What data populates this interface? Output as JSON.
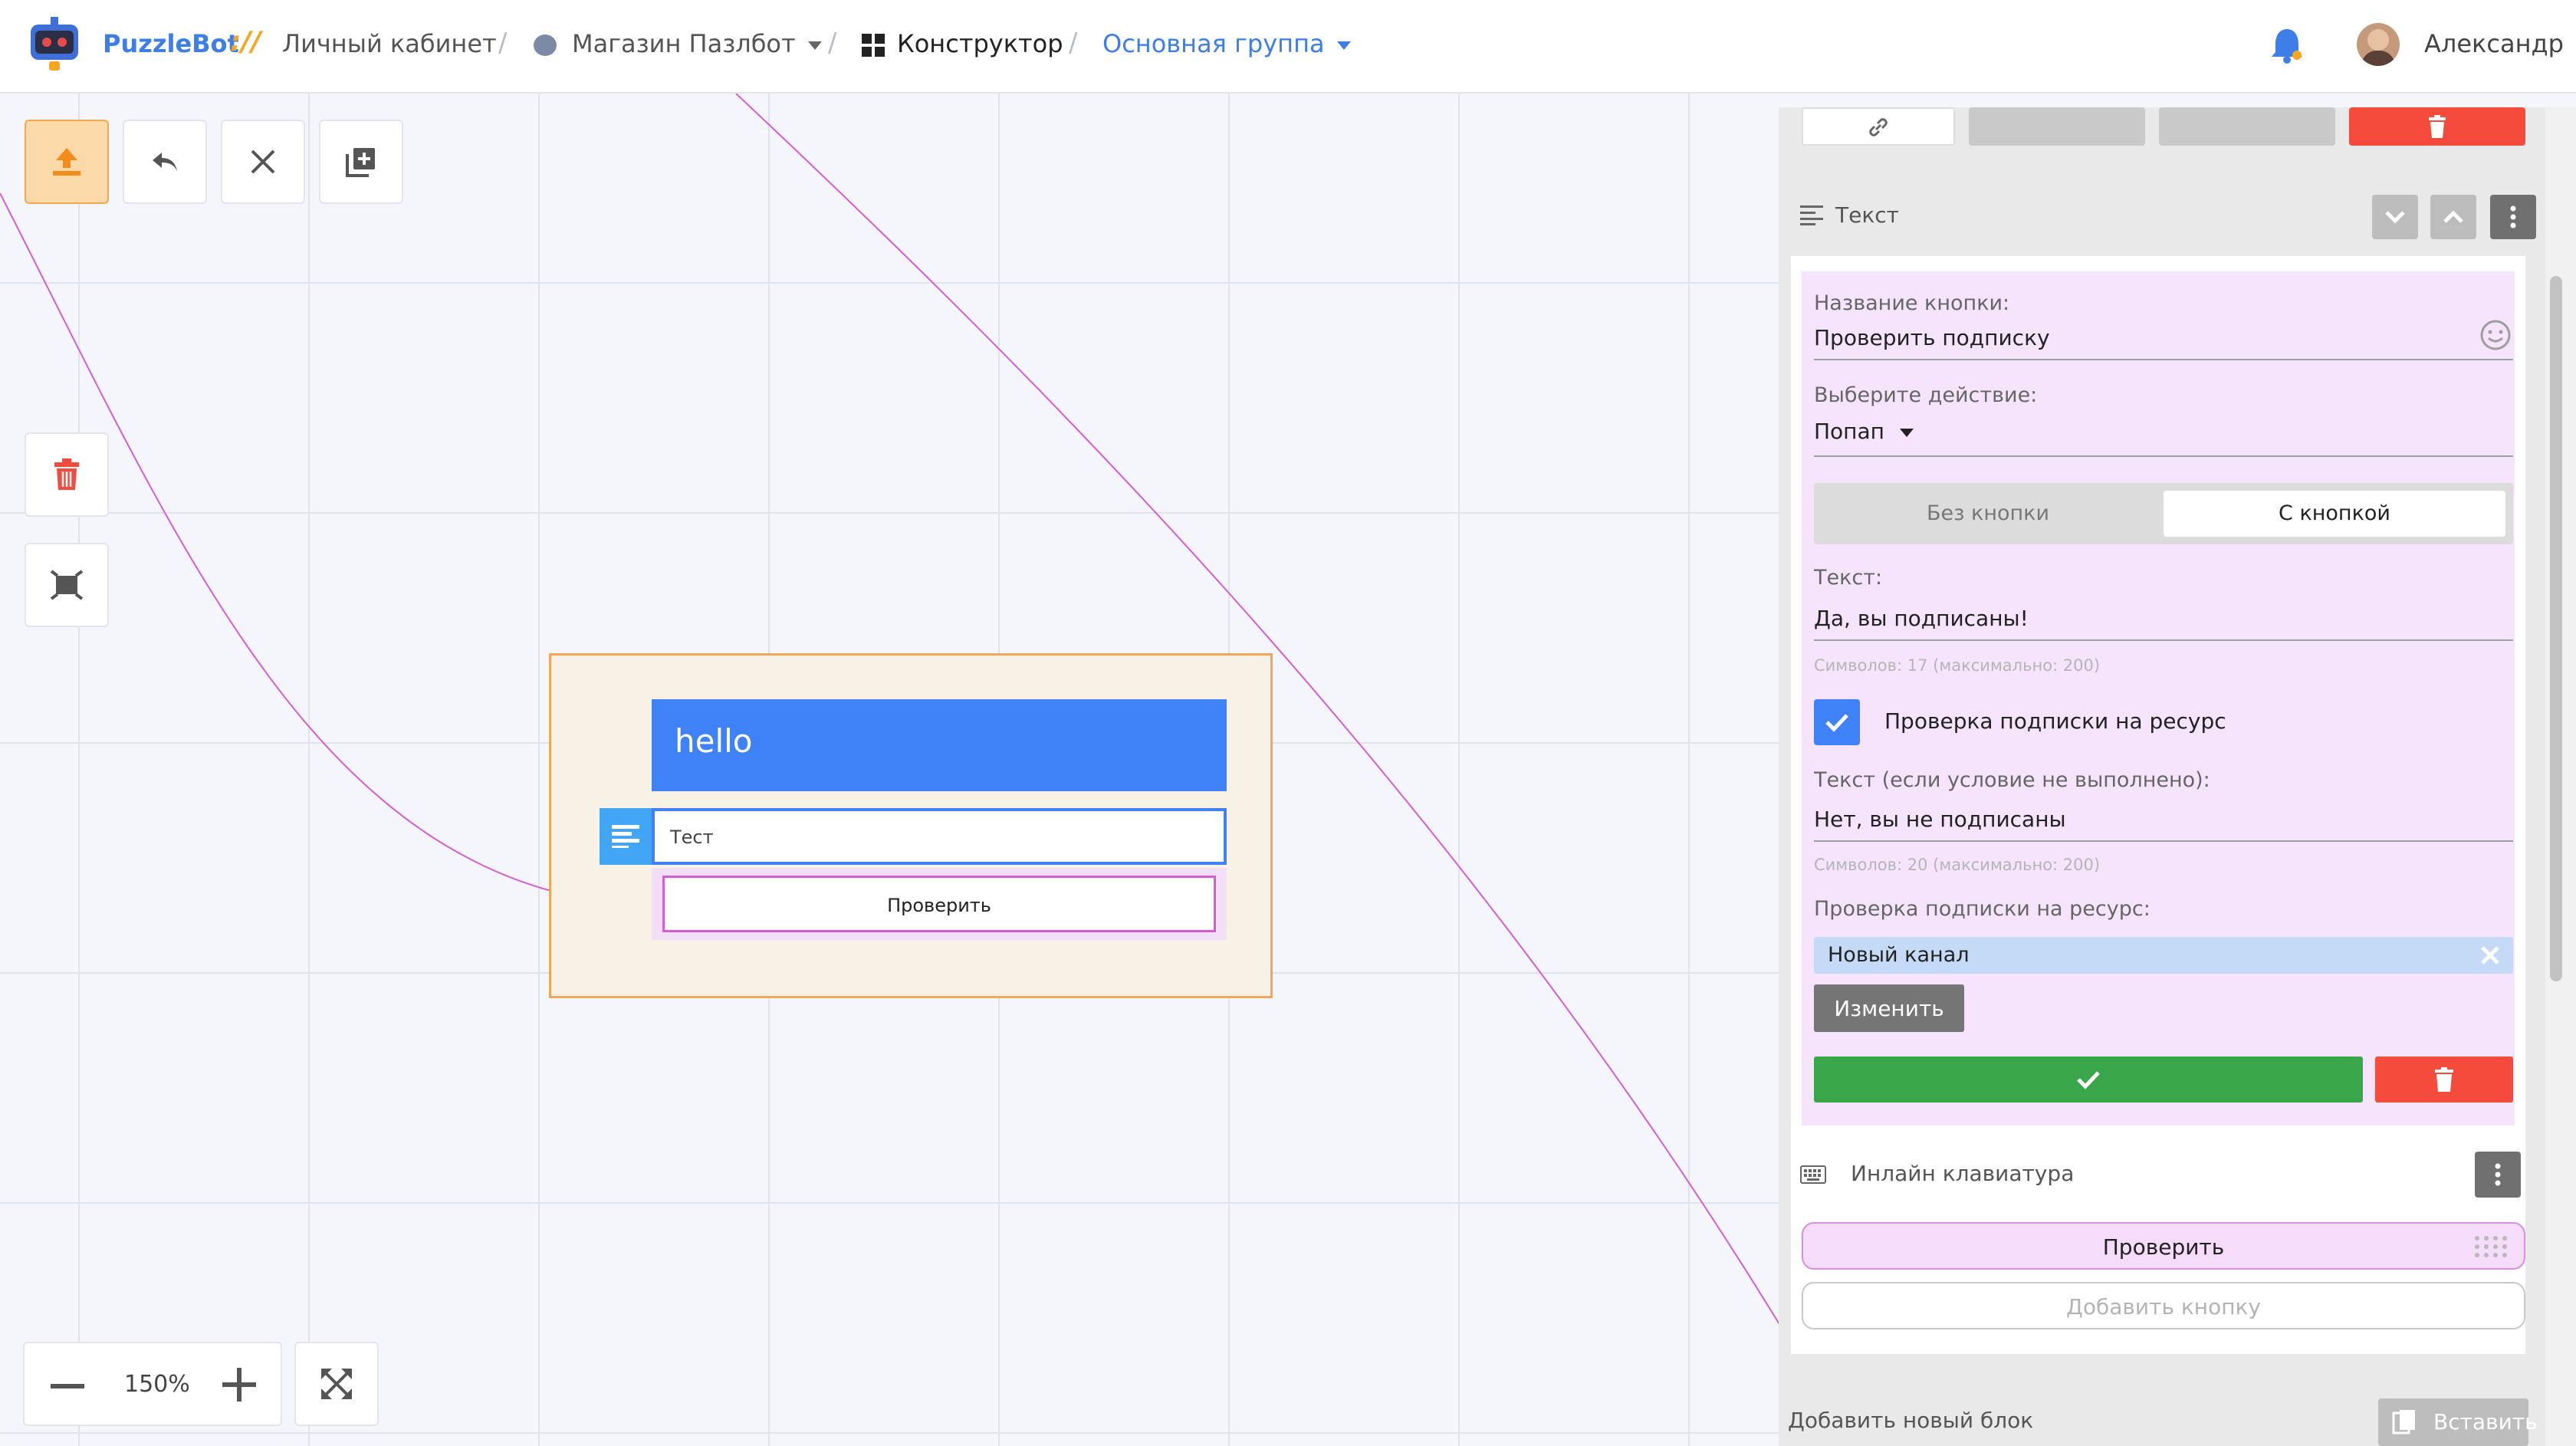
{
  "header": {
    "brand": "PuzzleBot",
    "brand_sep": "://",
    "crumbs": {
      "cabinet": "Личный кабинет",
      "shop": "Магазин Пазлбот",
      "constructor": "Конструктор",
      "group": "Основная группа"
    },
    "user": "Александр"
  },
  "canvas": {
    "zoom": "150%",
    "block": {
      "title": "hello",
      "text_item": "Тест",
      "button": "Проверить"
    }
  },
  "panel": {
    "section_title": "Текст",
    "form": {
      "button_name_label": "Название кнопки:",
      "button_name_value": "Проверить подписку",
      "action_label": "Выберите действие:",
      "action_value": "Попап",
      "seg_left": "Без кнопки",
      "seg_right": "С кнопкой",
      "text_label": "Текст:",
      "text_value": "Да, вы подписаны!",
      "text_hint": "Символов: 17 (максимально: 200)",
      "check_label": "Проверка подписки на ресурс",
      "alt_text_label": "Текст (если условие не выполнено):",
      "alt_text_value": "Нет, вы не подписаны",
      "alt_text_hint": "Символов: 20 (максимально: 200)",
      "resource_label": "Проверка подписки на ресурс:",
      "resource_chip": "Новый канал",
      "change_button": "Изменить"
    },
    "keyboard": {
      "title": "Инлайн клавиатура",
      "button": "Проверить",
      "add_button": "Добавить кнопку"
    },
    "add_block": "Добавить новый блок",
    "paste": "Вставить"
  },
  "colors": {
    "accent": "#3d7ee8",
    "primary_block": "#3f82f7",
    "success": "#3aa64a",
    "danger": "#f44b3c",
    "wire": "#d55ed5",
    "group_border": "#f2a65a"
  }
}
